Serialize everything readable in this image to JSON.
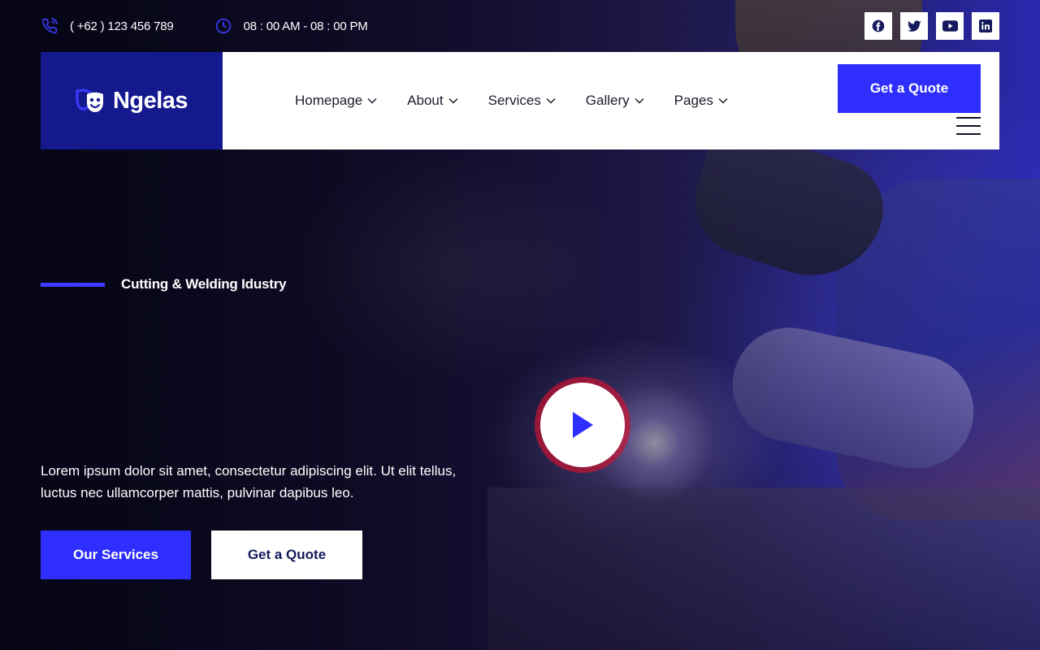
{
  "topbar": {
    "phone": "( +62 ) 123 456 789",
    "hours": "08 : 00 AM - 08 : 00 PM",
    "phone_icon": "phone-icon",
    "clock_icon": "clock-icon",
    "socials": [
      "facebook-icon",
      "twitter-icon",
      "youtube-icon",
      "linkedin-icon"
    ]
  },
  "header": {
    "brand": "Ngelas",
    "logo_icon": "masks-icon",
    "nav": [
      {
        "label": "Homepage"
      },
      {
        "label": "About"
      },
      {
        "label": "Services"
      },
      {
        "label": "Gallery"
      },
      {
        "label": "Pages"
      }
    ],
    "quote_label": "Get a Quote"
  },
  "hero": {
    "tagline": "Cutting & Welding Idustry",
    "description": "Lorem ipsum dolor sit amet, consectetur adipiscing elit. Ut elit tellus, luctus nec ullamcorper mattis, pulvinar dapibus leo.",
    "primary_button": "Our Services",
    "secondary_button": "Get a Quote",
    "play_icon": "play-icon"
  },
  "colors": {
    "accent": "#2e2eff",
    "logo_bg": "#141a8e",
    "play_ring": "#c81432"
  }
}
